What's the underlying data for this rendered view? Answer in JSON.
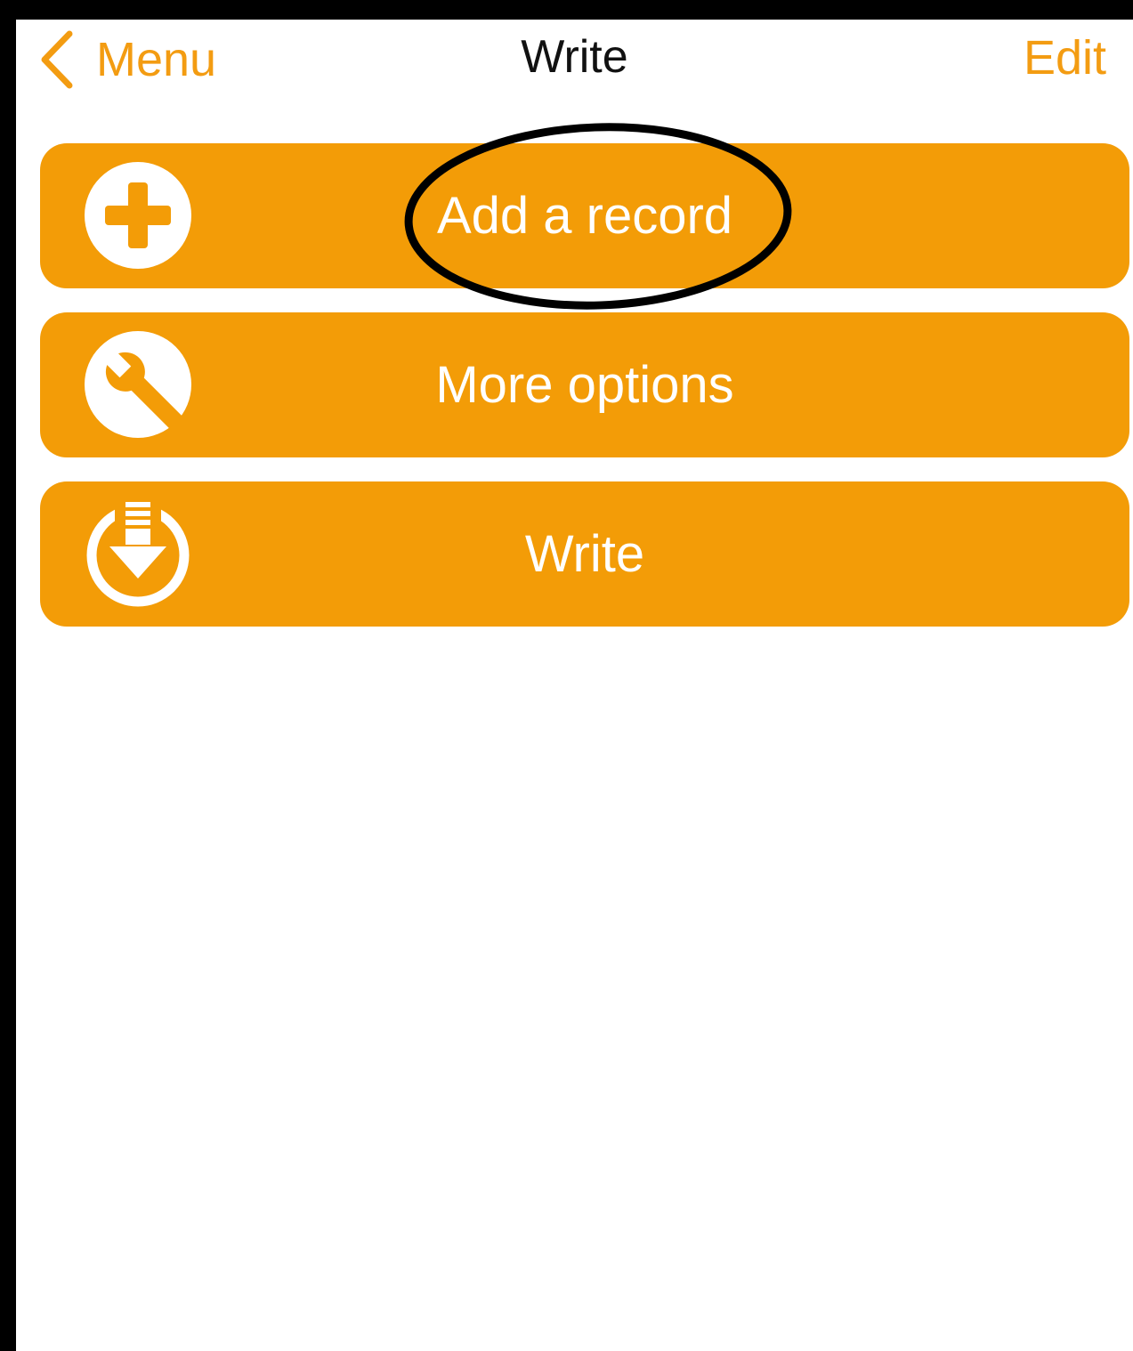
{
  "navbar": {
    "back_label": "Menu",
    "title": "Write",
    "edit_label": "Edit"
  },
  "menu": {
    "items": [
      {
        "label": "Add a record",
        "icon": "plus-circle-icon"
      },
      {
        "label": "More options",
        "icon": "wrench-circle-icon"
      },
      {
        "label": "Write",
        "icon": "download-arrow-circle-icon"
      }
    ]
  },
  "colors": {
    "accent": "#f39c07",
    "frame": "#000000",
    "background": "#ffffff",
    "annotation": "#000000"
  }
}
